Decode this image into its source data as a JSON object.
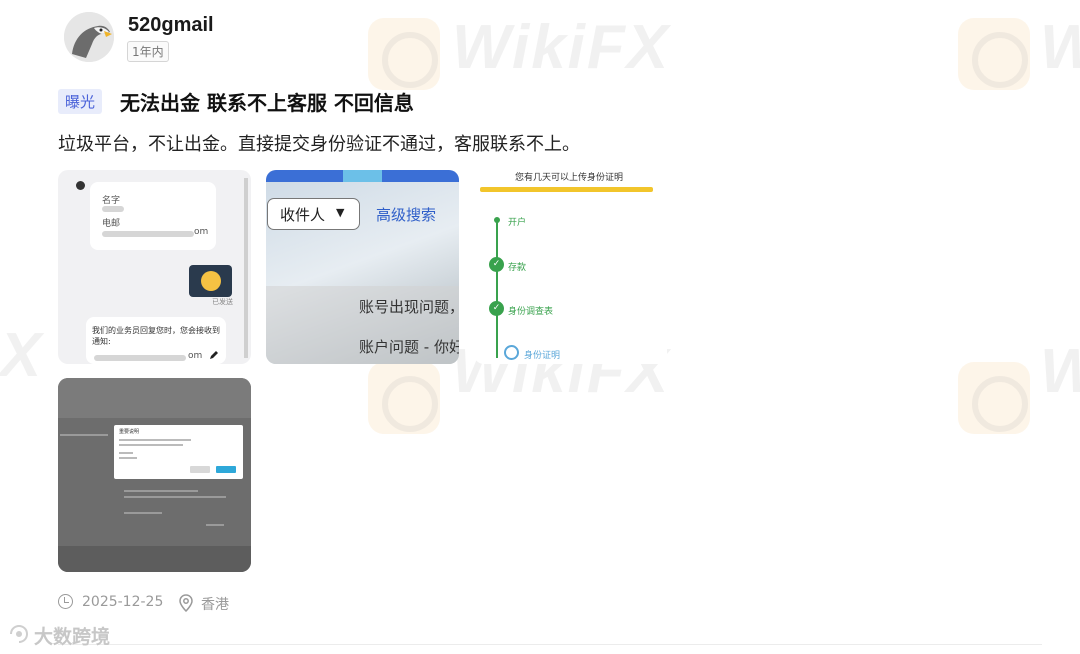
{
  "post": {
    "username": "520gmail",
    "time_tag": "1年内",
    "badge": "曝光",
    "title": "无法出金 联系不上客服 不回信息",
    "body": "垃圾平台，不让出金。直接提交身份验证不通过，客服联系不上。",
    "date": "2025-12-25",
    "location": "香港"
  },
  "images": {
    "chat": {
      "name_label": "名字",
      "phone_label": "电邮",
      "email_suffix": "om",
      "sent_label": "已发送",
      "reply_text": "我们的业务员回复您时，您会接收到通知:",
      "email_suffix2": "om"
    },
    "search": {
      "recipient_select": "收件人",
      "advanced_search": "高级搜索",
      "row1": "账号出现问题，",
      "row2": "账户问题 - 你好"
    },
    "progress": {
      "heading": "您有几天可以上传身份证明",
      "steps": [
        "开户",
        "存款",
        "身份调查表",
        "身份证明"
      ]
    },
    "dialog": {
      "title": "重要说明"
    }
  },
  "watermark": {
    "text": "WikiFX"
  },
  "footer": {
    "brand": "大数跨境"
  },
  "colors": {
    "badge_bg": "#e8ecfb",
    "badge_text": "#4a62d9",
    "progress_green": "#39a24d",
    "progress_bar": "#f2c52b",
    "link_blue": "#2f5fc9"
  }
}
